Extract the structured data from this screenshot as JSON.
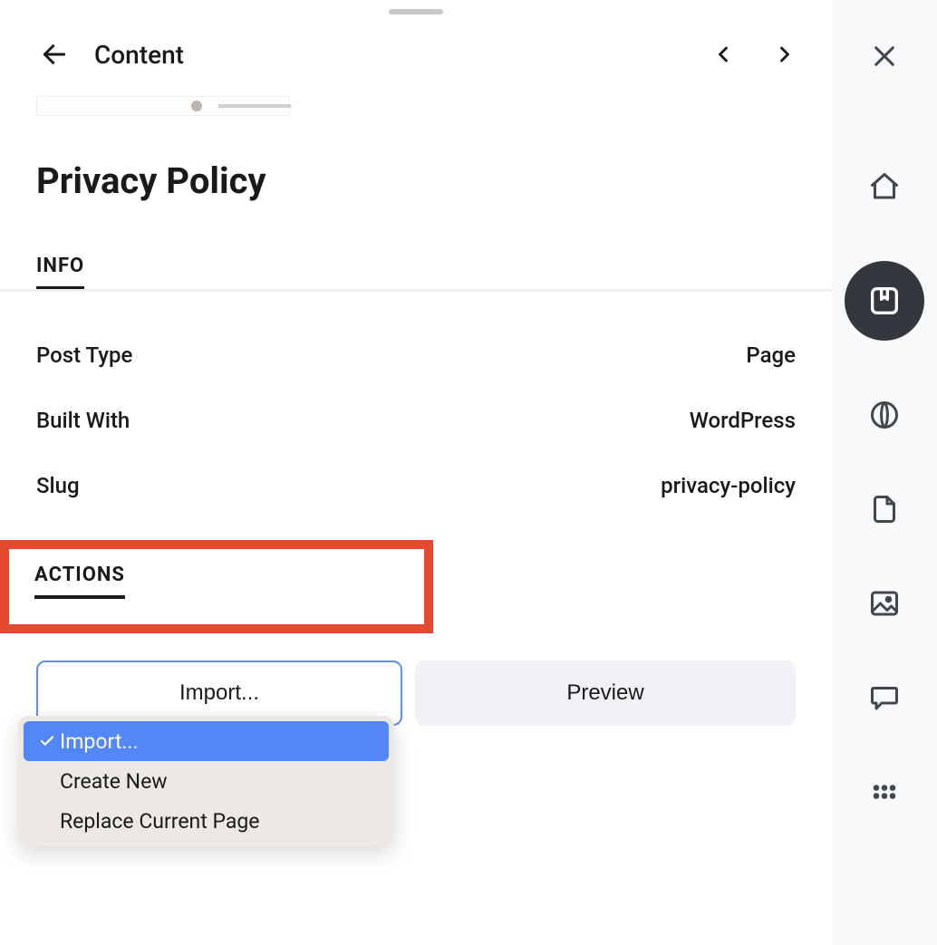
{
  "header": {
    "title": "Content"
  },
  "page": {
    "title": "Privacy Policy"
  },
  "info": {
    "tab_label": "INFO",
    "rows": [
      {
        "label": "Post Type",
        "value": "Page"
      },
      {
        "label": "Built With",
        "value": "WordPress"
      },
      {
        "label": "Slug",
        "value": "privacy-policy"
      }
    ]
  },
  "actions": {
    "tab_label": "ACTIONS",
    "import_label": "Import...",
    "preview_label": "Preview",
    "dropdown": [
      {
        "label": "Import...",
        "selected": true
      },
      {
        "label": "Create New",
        "selected": false
      },
      {
        "label": "Replace Current Page",
        "selected": false
      }
    ]
  },
  "icons": {
    "close": "close-icon",
    "home": "home-icon",
    "content": "bookmark-square-icon",
    "link": "link-icon",
    "file": "file-icon",
    "image": "image-icon",
    "comment": "comment-icon",
    "more": "more-grid-icon"
  }
}
